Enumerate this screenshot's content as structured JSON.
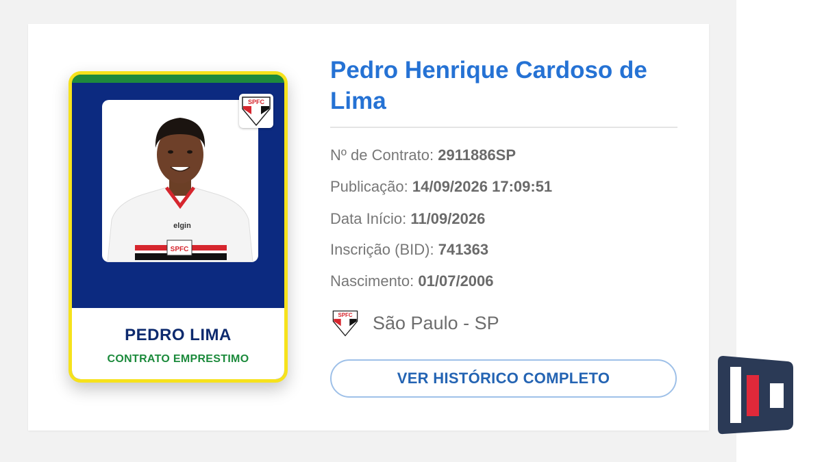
{
  "player_card": {
    "short_name": "PEDRO LIMA",
    "contract_type": "CONTRATO EMPRESTIMO",
    "club_badge_text": "SPFC",
    "shirt_sponsor": "elgin"
  },
  "details": {
    "full_name": "Pedro Henrique Cardoso de Lima",
    "rows": [
      {
        "label": "Nº de Contrato:",
        "value": "2911886SP"
      },
      {
        "label": "Publicação:",
        "value": "14/09/2026 17:09:51"
      },
      {
        "label": "Data Início:",
        "value": "11/09/2026"
      },
      {
        "label": "Inscrição (BID):",
        "value": "741363"
      },
      {
        "label": "Nascimento:",
        "value": "01/07/2006"
      }
    ],
    "club": "São Paulo - SP"
  },
  "history_button_label": "VER HISTÓRICO COMPLETO",
  "colors": {
    "accent_blue": "#2572d4",
    "card_navy": "#0c2a80",
    "card_border_yellow": "#f6e21c",
    "contract_green": "#1b8a3b",
    "club_red": "#e0293a"
  },
  "icons": {
    "club_badge": "spfc-crest-icon",
    "watermark": "publisher-logo-icon"
  }
}
